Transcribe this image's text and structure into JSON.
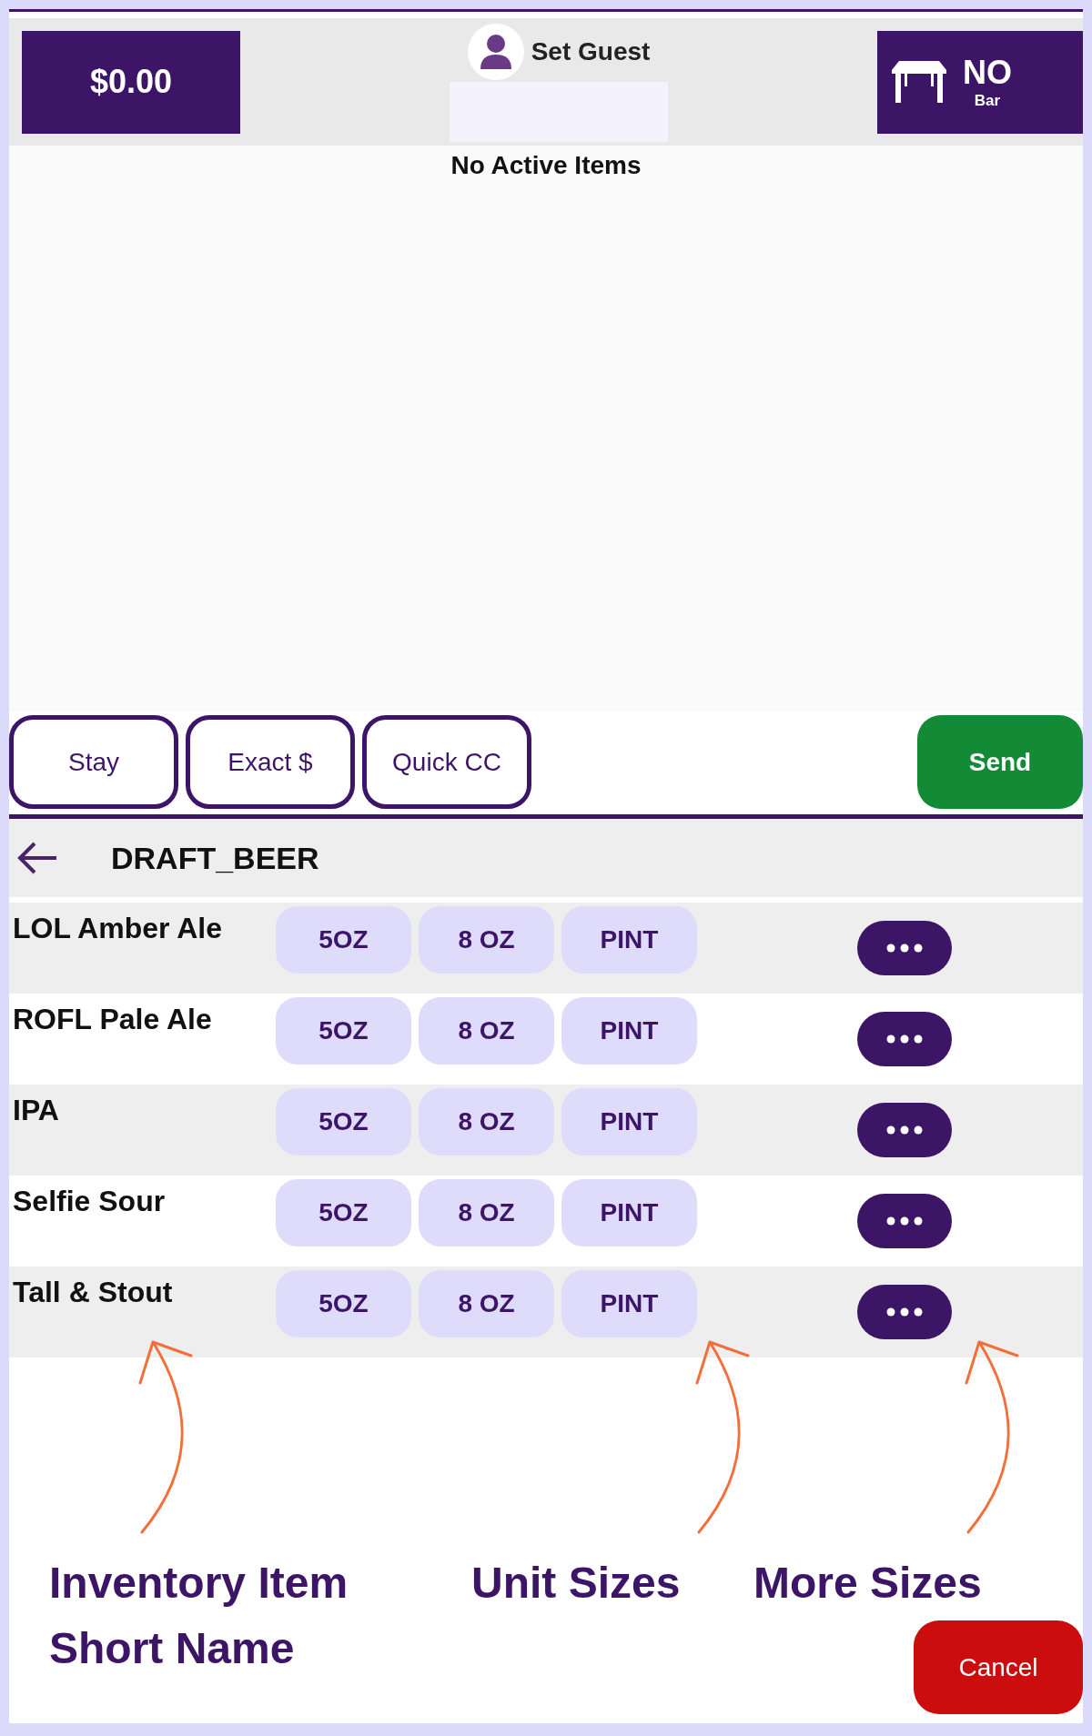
{
  "header": {
    "total": "$0.00",
    "guest": {
      "label": "Set Guest"
    },
    "table": {
      "number": "NO",
      "area": "Bar"
    }
  },
  "order": {
    "empty_message": "No Active Items"
  },
  "actions": [
    {
      "label": "Stay",
      "kind": "outline"
    },
    {
      "label": "Exact $",
      "kind": "outline"
    },
    {
      "label": "Quick CC",
      "kind": "outline"
    },
    {
      "label": "Send",
      "kind": "primary"
    }
  ],
  "category": {
    "title": "DRAFT_BEER"
  },
  "items": [
    {
      "name": "LOL Amber Ale",
      "sizes": [
        "5OZ",
        "8 OZ",
        "PINT"
      ]
    },
    {
      "name": "ROFL Pale Ale",
      "sizes": [
        "5OZ",
        "8 OZ",
        "PINT"
      ]
    },
    {
      "name": "IPA",
      "sizes": [
        "5OZ",
        "8 OZ",
        "PINT"
      ]
    },
    {
      "name": "Selfie Sour",
      "sizes": [
        "5OZ",
        "8 OZ",
        "PINT"
      ]
    },
    {
      "name": "Tall & Stout",
      "sizes": [
        "5OZ",
        "8 OZ",
        "PINT"
      ]
    }
  ],
  "annotations": [
    {
      "label": "Inventory Item Short Name"
    },
    {
      "label": "Unit Sizes"
    },
    {
      "label": "More Sizes"
    }
  ],
  "cancel": "Cancel"
}
